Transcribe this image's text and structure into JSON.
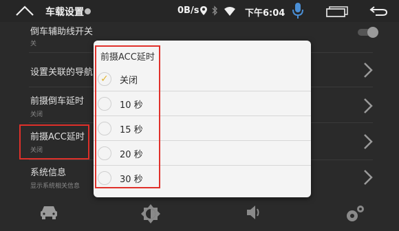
{
  "statusbar": {
    "app_title": "车载设置",
    "net_speed": "0B/s",
    "time": "下午6:04"
  },
  "settings": [
    {
      "title": "倒车辅助线开关",
      "subtitle": "关"
    },
    {
      "title": "设置关联的导航",
      "subtitle": ""
    },
    {
      "title": "前摄倒车延时",
      "subtitle": "关闭"
    },
    {
      "title": "前摄ACC延时",
      "subtitle": "关闭"
    },
    {
      "title": "系统信息",
      "subtitle": "显示系统相关信息"
    }
  ],
  "dialog": {
    "title": "前摄ACC延时",
    "options": [
      {
        "label": "关闭",
        "selected": true
      },
      {
        "label": "10 秒",
        "selected": false
      },
      {
        "label": "15 秒",
        "selected": false
      },
      {
        "label": "20 秒",
        "selected": false
      },
      {
        "label": "30 秒",
        "selected": false
      }
    ]
  },
  "icons": {
    "home": "home-outline-icon",
    "location": "location-pin-icon",
    "bluetooth": "bluetooth-icon",
    "wifi": "wifi-icon",
    "mic": "microphone-icon",
    "recent": "recent-apps-icon",
    "back": "back-arrow-icon",
    "car": "car-icon",
    "brightness": "brightness-icon",
    "volume": "volume-icon",
    "settings": "gears-icon"
  },
  "colors": {
    "accent_mic": "#4a8fd6",
    "highlight_box": "#e0302a",
    "check": "#e2b535"
  }
}
